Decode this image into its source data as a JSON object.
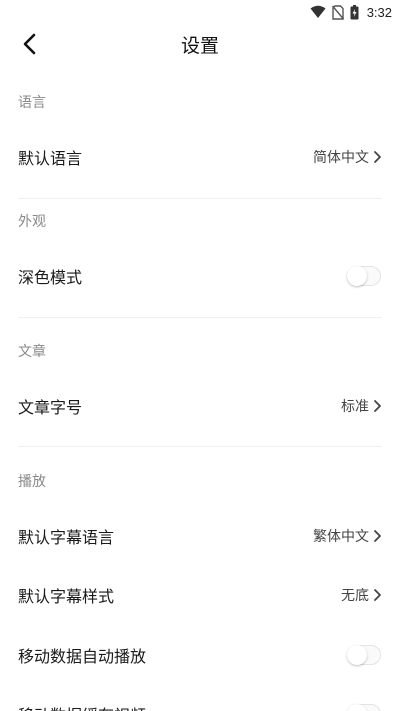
{
  "status_bar": {
    "time": "3:32",
    "icons": [
      "wifi-icon",
      "no-sim-icon",
      "battery-charging-icon"
    ]
  },
  "header": {
    "title": "设置",
    "back_icon": "chevron-left-icon"
  },
  "sections": {
    "language": {
      "title": "语言",
      "default_language": {
        "label": "默认语言",
        "value": "简体中文"
      }
    },
    "appearance": {
      "title": "外观",
      "dark_mode": {
        "label": "深色模式",
        "enabled": false
      }
    },
    "article": {
      "title": "文章",
      "font_size": {
        "label": "文章字号",
        "value": "标准"
      }
    },
    "playback": {
      "title": "播放",
      "subtitle_language": {
        "label": "默认字幕语言",
        "value": "繁体中文"
      },
      "subtitle_style": {
        "label": "默认字幕样式",
        "value": "无底"
      },
      "mobile_autoplay": {
        "label": "移动数据自动播放",
        "enabled": false
      },
      "mobile_cache": {
        "label": "移动数据缓存视频",
        "enabled": false
      }
    }
  },
  "colors": {
    "section_header": "#8a8a8a",
    "text_primary": "#1a1a1a",
    "divider": "#f0f0f0"
  }
}
